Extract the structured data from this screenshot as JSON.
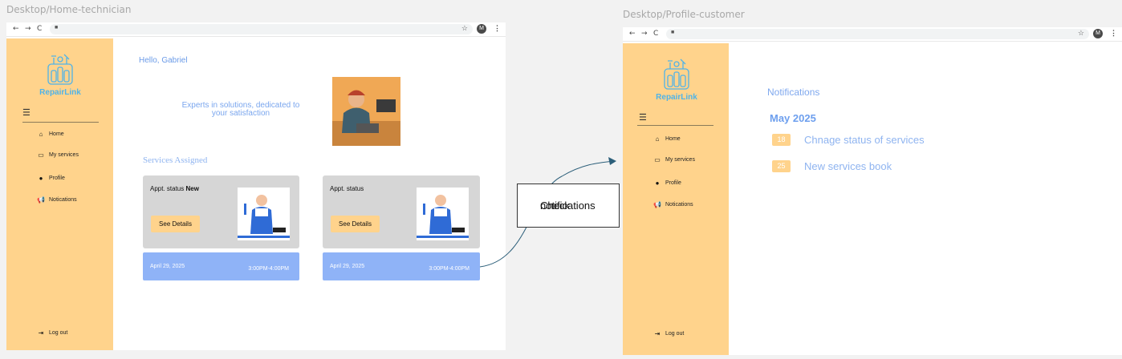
{
  "frames": [
    {
      "label": "Desktop/Home-technician",
      "browser": {
        "back": "←",
        "forward": "→",
        "reload": "C",
        "lock": "🔒",
        "star": "☆",
        "avatar": "M",
        "menu": "⋮"
      },
      "sidebar": {
        "logo_text": "RepairLink",
        "menu_icon": "☰",
        "items": [
          {
            "icon": "home-icon",
            "glyph": "⌂",
            "label": "Home"
          },
          {
            "icon": "folder-icon",
            "glyph": "▭",
            "label": "My services"
          },
          {
            "icon": "user-icon",
            "glyph": "●",
            "label": "Profile"
          },
          {
            "icon": "megaphone-icon",
            "glyph": "📢",
            "label": "Notications"
          }
        ],
        "logout": {
          "icon": "logout-icon",
          "glyph": "⇥",
          "label": "Log out"
        }
      },
      "main": {
        "greeting": "Hello, Gabriel",
        "tagline": "Experts in solutions, dedicated to your satisfaction",
        "section_title": "Services Assigned",
        "cards": [
          {
            "status_prefix": "Appt. status",
            "status_value": "New",
            "button": "See Details",
            "date": "April 29, 2025",
            "time": "3:00PM-4:00PM"
          },
          {
            "status_prefix": "Appt. status",
            "status_value": "",
            "button": "See Details",
            "date": "April 29, 2025",
            "time": "3:00PM-4:00PM"
          }
        ]
      }
    },
    {
      "label": "Desktop/Profile-customer",
      "browser": {
        "back": "←",
        "forward": "→",
        "reload": "C",
        "lock": "🔒",
        "star": "☆",
        "avatar": "M",
        "menu": "⋮"
      },
      "sidebar": {
        "logo_text": "RepairLink",
        "menu_icon": "☰",
        "items": [
          {
            "icon": "home-icon",
            "glyph": "⌂",
            "label": "Home"
          },
          {
            "icon": "folder-icon",
            "glyph": "▭",
            "label": "My services"
          },
          {
            "icon": "user-icon",
            "glyph": "●",
            "label": "Profile"
          },
          {
            "icon": "megaphone-icon",
            "glyph": "📢",
            "label": "Notications"
          }
        ],
        "logout": {
          "icon": "logout-icon",
          "glyph": "⇥",
          "label": "Log out"
        }
      },
      "main": {
        "title": "Notifications",
        "month": "May 2025",
        "notifications": [
          {
            "day": "18",
            "text": "Chnage status of services"
          },
          {
            "day": "25",
            "text": "New services book"
          }
        ]
      }
    }
  ],
  "callout": {
    "line1": "Check",
    "line2": "notifications"
  },
  "colors": {
    "sidebar": "#ffd38c",
    "accent": "#8fb3f7",
    "card": "#d6d6d6"
  }
}
